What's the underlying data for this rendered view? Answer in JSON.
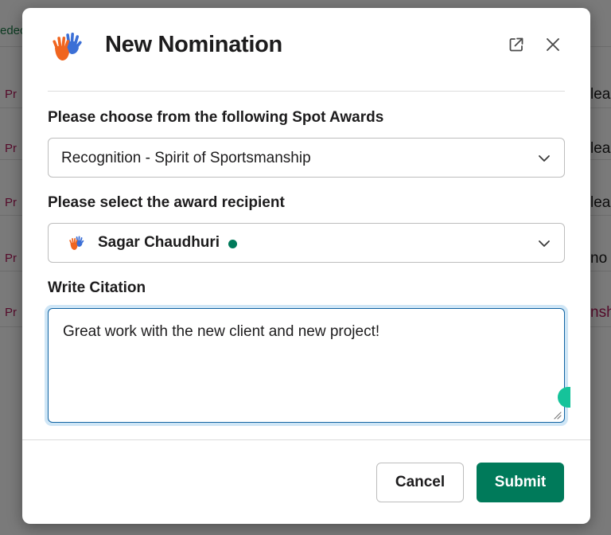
{
  "background": {
    "top_left_fragment": "edec",
    "left_fragments": [
      "Pr",
      "Pr",
      "Pr",
      "Pr",
      "Pr"
    ],
    "right_fragments": [
      "lea",
      "lea",
      "lea",
      "no",
      "nsh"
    ]
  },
  "modal": {
    "title": "New Nomination",
    "icons": {
      "app_logo": "hands-logo",
      "open_external": "external-link-icon",
      "close": "close-icon"
    },
    "award_field": {
      "label": "Please choose from the following Spot Awards",
      "selected_value": "Recognition - Spirit of Sportsmanship"
    },
    "recipient_field": {
      "label": "Please select the award recipient",
      "selected_value": "Sagar Chaudhuri",
      "status": "active"
    },
    "citation_field": {
      "label": "Write Citation",
      "value": "Great work with the new client and new project!"
    },
    "buttons": {
      "cancel": "Cancel",
      "submit": "Submit"
    },
    "colors": {
      "primary": "#007a5a",
      "focus_border": "#1264a3",
      "presence": "#007a5a"
    }
  }
}
